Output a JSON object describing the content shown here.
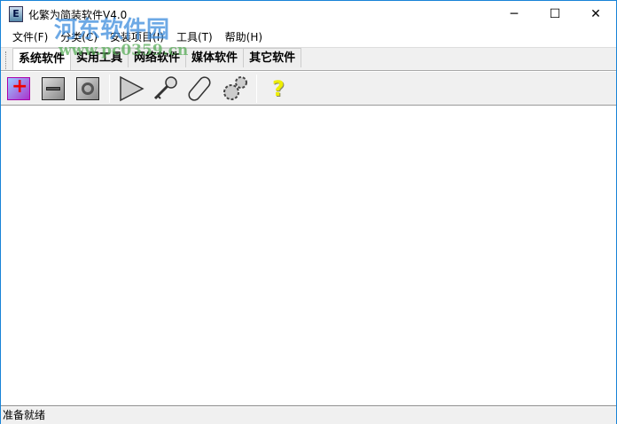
{
  "window": {
    "title": "化繁为简装软件V4.0",
    "minimize": "─",
    "maximize": "☐",
    "close": "✕"
  },
  "menu": [
    "文件(F)",
    "分类(C)",
    "安装项目(I)",
    "工具(T)",
    "帮助(H)"
  ],
  "tabs": [
    "系统软件",
    "实用工具",
    "网络软件",
    "媒体软件",
    "其它软件"
  ],
  "toolbar": {
    "buttons": [
      "add-icon",
      "remove-icon",
      "option-icon",
      "run-icon",
      "key-icon",
      "pill-icon",
      "gears-icon",
      "help-icon"
    ],
    "help_glyph": "?"
  },
  "status": "准备就绪",
  "watermark": {
    "name": "河东软件园",
    "url": "www.pc0359.cn"
  }
}
